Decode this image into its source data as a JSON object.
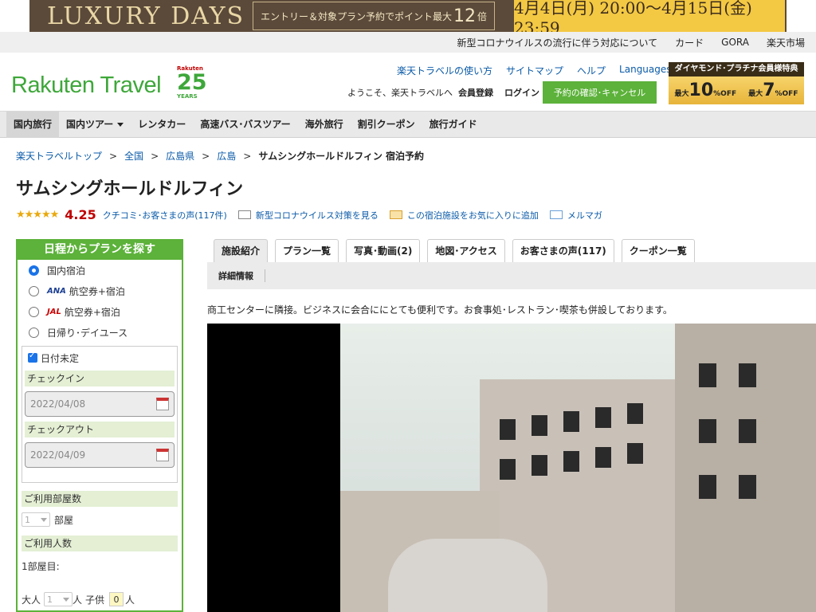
{
  "banner": {
    "left_text": "LUXURY DAYS",
    "mid_text_pre": "エントリー＆対象プラン予約でポイント最大",
    "mid_text_num": "12",
    "mid_text_post": "倍",
    "dates_text": "4月4日(月) 20:00～4月15日(金) 23:59"
  },
  "util_nav": [
    "新型コロナウイルスの流行に伴う対応について",
    "カード",
    "GORA",
    "楽天市場"
  ],
  "header": {
    "logo": "Rakuten Travel",
    "logo25": {
      "top": "Rakuten",
      "num": "25",
      "bottom": "YEARS"
    },
    "links": [
      "楽天トラベルの使い方",
      "サイトマップ",
      "ヘルプ",
      "Languages"
    ],
    "welcome": "ようこそ、楽天トラベルへ",
    "register": "会員登録",
    "login": "ログイン",
    "reservation_button": "予約の確認･キャンセル",
    "diamond": {
      "title": "ダイヤモンド･プラチナ会員様特典",
      "offer1": "10",
      "offer2": "7",
      "offer_unit": "%OFF",
      "offer_label": "最大"
    }
  },
  "main_nav": [
    "国内旅行",
    "国内ツアー",
    "レンタカー",
    "高速バス･バスツアー",
    "海外旅行",
    "割引クーポン",
    "旅行ガイド"
  ],
  "breadcrumb": [
    "楽天トラベルトップ",
    "全国",
    "広島県",
    "広島",
    "サムシングホールドルフィン 宿泊予約"
  ],
  "breadcrumb_sep": ">",
  "hotel": {
    "name": "サムシングホールドルフィン",
    "stars": "★★★★★",
    "score": "4.25",
    "reviews_link": "クチコミ･お客さまの声(117件)",
    "covid_link": "新型コロナウイルス対策を見る",
    "fav_link": "この宿泊施設をお気に入りに追加",
    "mail_link": "メルマガ",
    "description": "商工センターに隣接。ビジネスに会合ににとても便利です。お食事処･レストラン･喫茶も併設しております。"
  },
  "search": {
    "header": "日程からプランを探す",
    "options": [
      "国内宿泊",
      "航空券+宿泊",
      "航空券+宿泊",
      "日帰り･デイユース"
    ],
    "airline_ana": "ANA",
    "airline_jal": "JAL",
    "date_undecided": "日付未定",
    "checkin_label": "チェックイン",
    "checkin_value": "2022/04/08",
    "checkout_label": "チェックアウト",
    "checkout_value": "2022/04/09",
    "rooms_label": "ご利用部屋数",
    "rooms_value": "1",
    "rooms_unit": "部屋",
    "people_label": "ご利用人数",
    "room1_label": "1部屋目:",
    "adult_label": "大人",
    "adult_value": "1",
    "person_unit": "人",
    "child_label": "子供",
    "child_value": "0"
  },
  "tabs": [
    "施設紹介",
    "プラン一覧",
    "写真･動画(2)",
    "地図･アクセス",
    "お客さまの声(117)",
    "クーポン一覧"
  ],
  "subtab": "詳細情報"
}
